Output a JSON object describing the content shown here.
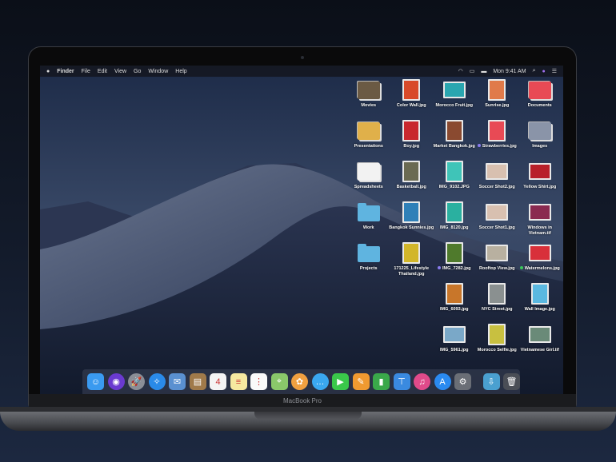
{
  "device": {
    "label": "MacBook Pro"
  },
  "menubar": {
    "apple": "",
    "app": "Finder",
    "menus": [
      "File",
      "Edit",
      "View",
      "Go",
      "Window",
      "Help"
    ],
    "clock": "Mon 9:41 AM"
  },
  "desktop": {
    "columns": [
      [
        {
          "label": "Movies",
          "kind": "stack",
          "color": "#6b5a44"
        },
        {
          "label": "Presentations",
          "kind": "stack",
          "color": "#e0b04a"
        },
        {
          "label": "Spreadsheets",
          "kind": "stack",
          "color": "#f2f2f2"
        },
        {
          "label": "Work",
          "kind": "folder"
        },
        {
          "label": "Projects",
          "kind": "folder"
        }
      ],
      [
        {
          "label": "Color Wall.jpg",
          "kind": "photo",
          "color": "#d84a2a"
        },
        {
          "label": "Boy.jpg",
          "kind": "photo",
          "color": "#c8282e"
        },
        {
          "label": "Basketball.jpg",
          "kind": "photo",
          "color": "#6a6a52"
        },
        {
          "label": "Bangkok Sunnies.jpg",
          "kind": "photo",
          "color": "#2f80b8"
        },
        {
          "label": "171225_Lifestyle Thailand.jpg",
          "kind": "photo",
          "color": "#d2b62a"
        }
      ],
      [
        {
          "label": "Morocco Fruit.jpg",
          "kind": "wide",
          "color": "#2aa6b0"
        },
        {
          "label": "Market Bangkok.jpg",
          "kind": "photo",
          "color": "#8a4a30"
        },
        {
          "label": "IMG_9102.JPG",
          "kind": "photo",
          "color": "#3fc4b8"
        },
        {
          "label": "IMG_8120.jpg",
          "kind": "photo",
          "color": "#2ab0a0"
        },
        {
          "label": "IMG_7282.jpg",
          "kind": "photo",
          "color": "#4f7a2c",
          "tag": "#8a7cf0"
        },
        {
          "label": "IMG_6093.jpg",
          "kind": "photo",
          "color": "#c8762a"
        },
        {
          "label": "IMG_5961.jpg",
          "kind": "wide",
          "color": "#7aa8c8"
        }
      ],
      [
        {
          "label": "Sunrise.jpg",
          "kind": "photo",
          "color": "#e07a4a"
        },
        {
          "label": "Strawberries.jpg",
          "kind": "photo",
          "color": "#e84a55",
          "tag": "#8a7cf0"
        },
        {
          "label": "Soccer Shot2.jpg",
          "kind": "wide",
          "color": "#d8c0b0"
        },
        {
          "label": "Soccer Shot1.jpg",
          "kind": "wide",
          "color": "#d8c0b0"
        },
        {
          "label": "Rooftop View.jpg",
          "kind": "wide",
          "color": "#b8b0a0"
        },
        {
          "label": "NYC Street.jpg",
          "kind": "photo",
          "color": "#8a9090"
        },
        {
          "label": "Morocco Selfie.jpg",
          "kind": "photo",
          "color": "#c8c040"
        }
      ],
      [
        {
          "label": "Documents",
          "kind": "stack",
          "color": "#e84a55"
        },
        {
          "label": "Images",
          "kind": "stack",
          "color": "#8a94a8"
        },
        {
          "label": "Yellow Shirt.jpg",
          "kind": "wide",
          "color": "#b8202a"
        },
        {
          "label": "Windows in Vietnam.tif",
          "kind": "wide",
          "color": "#8a2a50"
        },
        {
          "label": "Watermelons.jpg",
          "kind": "wide",
          "color": "#d8303a",
          "tag": "#3ac85a"
        },
        {
          "label": "Wall Image.jpg",
          "kind": "photo",
          "color": "#5ab8e0"
        },
        {
          "label": "Vietnamese Girl.tif",
          "kind": "wide",
          "color": "#6a8a78"
        }
      ]
    ]
  },
  "dock": {
    "apps": [
      {
        "name": "finder",
        "color": "#3a9af0",
        "glyph": "☺"
      },
      {
        "name": "siri",
        "color": "#6a3ad0",
        "glyph": "◉",
        "round": true
      },
      {
        "name": "launchpad",
        "color": "#8a8e96",
        "glyph": "🚀",
        "round": true
      },
      {
        "name": "safari",
        "color": "#2a8ae8",
        "glyph": "✧",
        "round": true
      },
      {
        "name": "mail",
        "color": "#5a90d0",
        "glyph": "✉"
      },
      {
        "name": "contacts",
        "color": "#a07a4a",
        "glyph": "▤"
      },
      {
        "name": "calendar",
        "color": "#f4f4f4",
        "glyph": "4"
      },
      {
        "name": "notes",
        "color": "#f6e9a0",
        "glyph": "≡"
      },
      {
        "name": "reminders",
        "color": "#fafafa",
        "glyph": "⋮"
      },
      {
        "name": "maps",
        "color": "#8ac86a",
        "glyph": "⌖"
      },
      {
        "name": "photos",
        "color": "#f0a040",
        "glyph": "✿",
        "round": true
      },
      {
        "name": "messages",
        "color": "#3aa8f0",
        "glyph": "…",
        "round": true
      },
      {
        "name": "facetime",
        "color": "#3ac84a",
        "glyph": "▶"
      },
      {
        "name": "pages",
        "color": "#f09a30",
        "glyph": "✎"
      },
      {
        "name": "numbers",
        "color": "#3aa84a",
        "glyph": "▮"
      },
      {
        "name": "keynote",
        "color": "#3a8ae0",
        "glyph": "⊤"
      },
      {
        "name": "itunes",
        "color": "#e04a8a",
        "glyph": "♫",
        "round": true
      },
      {
        "name": "app-store",
        "color": "#2a8af0",
        "glyph": "A",
        "round": true
      },
      {
        "name": "system-preferences",
        "color": "#6a6e76",
        "glyph": "⚙"
      }
    ],
    "extras": [
      {
        "name": "downloads-folder",
        "color": "#4aa0d0",
        "glyph": "⇩"
      },
      {
        "name": "trash",
        "color": "#4a4e56",
        "glyph": "🗑"
      }
    ]
  }
}
